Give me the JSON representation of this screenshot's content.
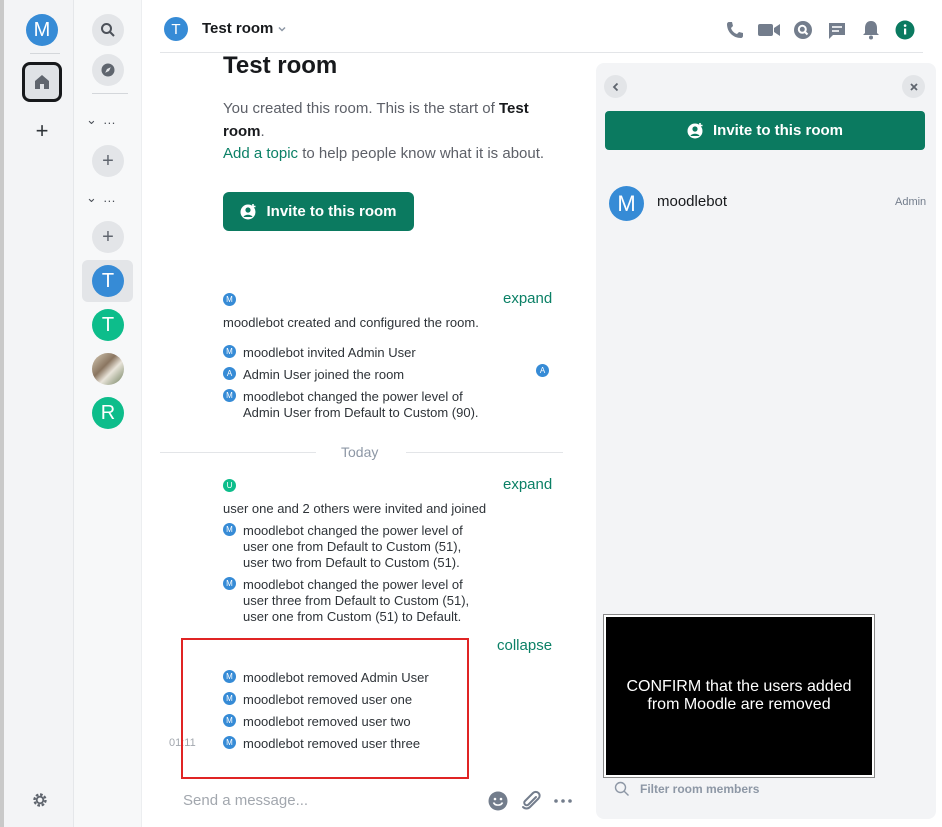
{
  "spaces": {
    "user_initial": "M",
    "home_label": "Home",
    "add_symbol": "+"
  },
  "roomlist": {
    "section1": "…",
    "section2": "…",
    "add_symbol": "+",
    "rooms": [
      {
        "initial": "T",
        "color": "#368bd6"
      },
      {
        "initial": "T",
        "color": "#0dbd8b"
      },
      {
        "initial": "",
        "color": "#7a8a70"
      },
      {
        "initial": "R",
        "color": "#0dbd8b"
      }
    ]
  },
  "header": {
    "avatar_initial": "T",
    "room_name": "Test room"
  },
  "room_intro": {
    "title": "Test room",
    "created_prefix": "You created this room. This is the start of ",
    "created_room": "Test room",
    "created_suffix": ".",
    "add_topic": "Add a topic",
    "topic_suffix": " to help people know what it is about.",
    "invite_button": "Invite to this room"
  },
  "timeline": {
    "group1": {
      "expand": "expand",
      "summary": "moodlebot created and configured the room.",
      "events": [
        {
          "initial": "M",
          "text": "moodlebot invited Admin User"
        },
        {
          "initial": "A",
          "text": "Admin User joined the room"
        },
        {
          "initial": "M",
          "text": "moodlebot changed the power level of Admin User from Default to Custom (90)."
        }
      ],
      "read_receipt": "A"
    },
    "date_separator": "Today",
    "group2": {
      "expand": "expand",
      "summary": "user one and 2 others were invited and joined",
      "events": [
        {
          "initial": "M",
          "text": "moodlebot changed the power level of user one from Default to Custom (51), user two from Default to Custom (51)."
        },
        {
          "initial": "M",
          "text": "moodlebot changed the power level of user three from Default to Custom (51), user one from Custom (51) to Default."
        }
      ]
    },
    "group3": {
      "collapse": "collapse",
      "timestamp": "01:11",
      "events": [
        {
          "initial": "M",
          "text": "moodlebot removed Admin User"
        },
        {
          "initial": "M",
          "text": "moodlebot removed user one"
        },
        {
          "initial": "M",
          "text": "moodlebot removed user two"
        },
        {
          "initial": "M",
          "text": "moodlebot removed user three"
        }
      ]
    }
  },
  "composer": {
    "placeholder": "Send a message..."
  },
  "right_panel": {
    "invite_button": "Invite to this room",
    "members": [
      {
        "initial": "M",
        "name": "moodlebot",
        "role": "Admin"
      }
    ],
    "filter_placeholder": "Filter room members"
  },
  "overlay": {
    "text": "CONFIRM that the users added from Moodle are removed"
  },
  "colors": {
    "accent": "#0b7a60",
    "avatar_blue": "#368bd6",
    "avatar_green": "#0dbd8b",
    "highlight_red": "#e02424"
  }
}
